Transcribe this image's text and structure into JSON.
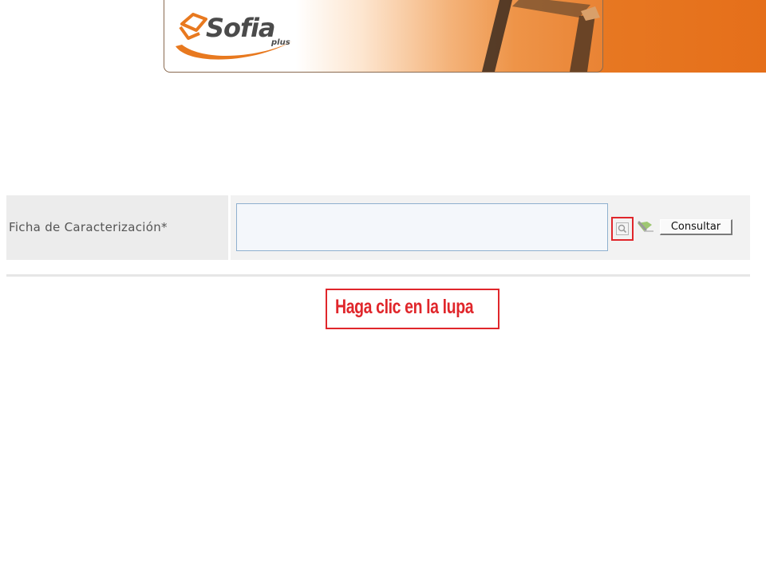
{
  "header": {
    "logo_text": "Sofia",
    "logo_subtext": "plus"
  },
  "form": {
    "field_label": "Ficha de Caracterización*",
    "field_value": "",
    "search_icon": "magnifier-icon",
    "clear_icon": "eraser-icon",
    "consultar_label": "Consultar"
  },
  "annotation": {
    "text": "Haga clic en la lupa"
  },
  "colors": {
    "brand_orange": "#e56f1a",
    "annotation_red": "#e0262b",
    "input_border": "#8fb0cf"
  }
}
